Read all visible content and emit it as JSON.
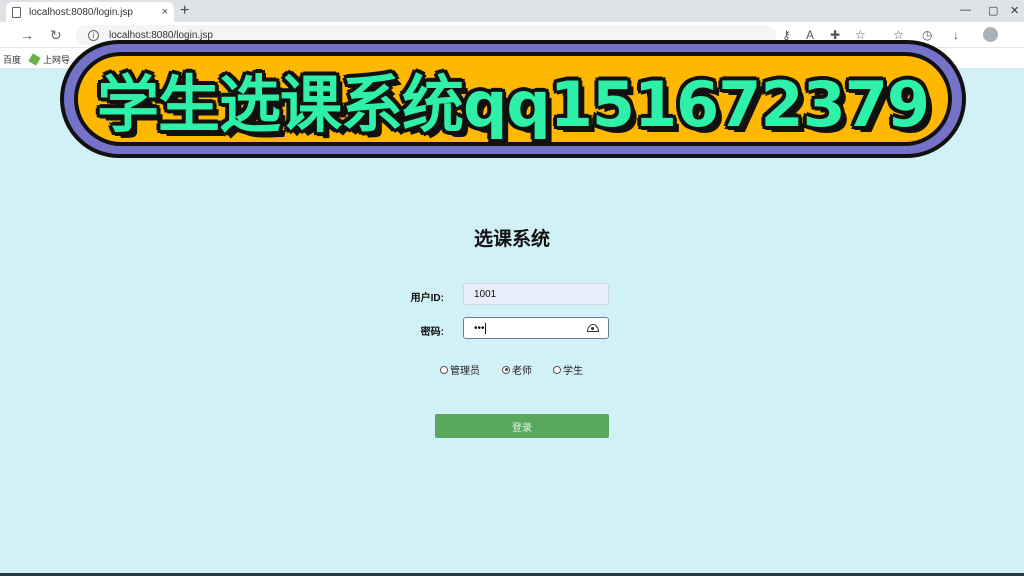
{
  "browser": {
    "tab_title": "localhost:8080/login.jsp",
    "tab_close": "×",
    "new_tab": "+",
    "url": "localhost:8080/login.jsp",
    "bookmarks": [
      "百度",
      "上网导"
    ]
  },
  "banner": {
    "text": "学生选课系统qq151672379",
    "colors": {
      "fill": "#ffb800",
      "ring": "#7473c9",
      "text": "#2ff0a9"
    }
  },
  "login": {
    "title": "选课系统",
    "user_label": "用户ID:",
    "user_value": "1001",
    "password_label": "密码:",
    "password_value": "•••",
    "roles": [
      {
        "label": "管理员",
        "checked": false
      },
      {
        "label": "老师",
        "checked": true
      },
      {
        "label": "学生",
        "checked": false
      }
    ],
    "submit_label": "登录",
    "colors": {
      "background": "#d2f1f6",
      "button": "#5aa85e"
    }
  }
}
